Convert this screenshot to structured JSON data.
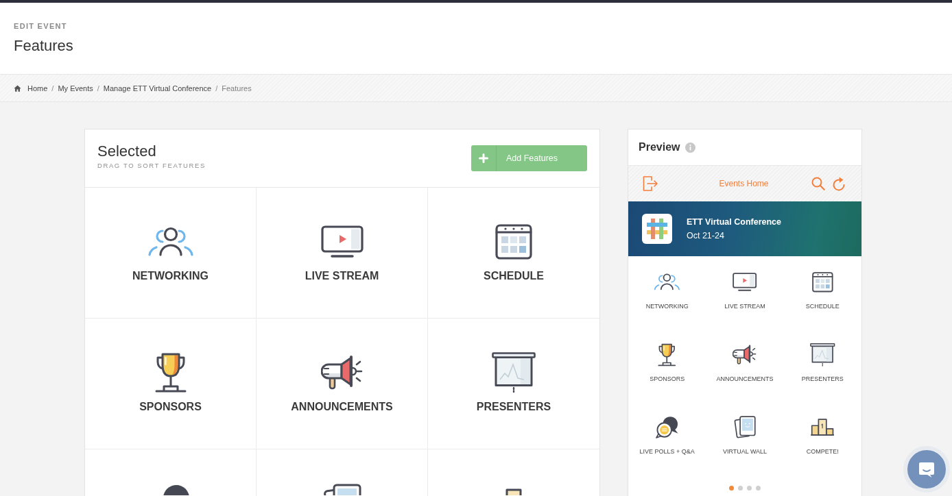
{
  "page": {
    "overline": "EDIT EVENT",
    "title": "Features"
  },
  "breadcrumb": {
    "items": [
      {
        "kind": "home",
        "label": "Home",
        "current": false
      },
      {
        "kind": "page",
        "label": "My Events",
        "current": false,
        "separator": "/"
      },
      {
        "kind": "page",
        "label": "Manage ETT Virtual Conference",
        "current": false,
        "separator": "/"
      },
      {
        "kind": "page",
        "label": "Features",
        "current": true,
        "separator": "/"
      }
    ]
  },
  "selected_panel": {
    "title": "Selected",
    "subtitle": "DRAG TO SORT FEATURES",
    "add_button": "Add Features",
    "features": [
      {
        "kind": "people",
        "label": "NETWORKING"
      },
      {
        "kind": "screen",
        "label": "LIVE STREAM"
      },
      {
        "kind": "calendar",
        "label": "SCHEDULE"
      },
      {
        "kind": "trophy",
        "label": "SPONSORS"
      },
      {
        "kind": "megaphone",
        "label": "ANNOUNCEMENTS"
      },
      {
        "kind": "projector",
        "label": "PRESENTERS"
      },
      {
        "kind": "bubbles"
      },
      {
        "kind": "cards"
      },
      {
        "kind": "podium"
      }
    ]
  },
  "preview": {
    "title": "Preview",
    "app_bar": {
      "title": "Events Home"
    },
    "event": {
      "name": "ETT Virtual Conference",
      "dates": "Oct 21-24"
    },
    "features": [
      {
        "kind": "people",
        "label": "NETWORKING"
      },
      {
        "kind": "screen",
        "label": "LIVE STREAM"
      },
      {
        "kind": "calendar",
        "label": "SCHEDULE"
      },
      {
        "kind": "trophy",
        "label": "SPONSORS"
      },
      {
        "kind": "megaphone",
        "label": "ANNOUNCEMENTS"
      },
      {
        "kind": "projector",
        "label": "PRESENTERS"
      },
      {
        "kind": "bubbles",
        "label": "LIVE POLLS + Q&A"
      },
      {
        "kind": "cards",
        "label": "VIRTUAL WALL"
      },
      {
        "kind": "podium",
        "label": "COMPETE!"
      }
    ],
    "pages": [
      {
        "selected": true
      },
      {
        "selected": false
      },
      {
        "selected": false
      },
      {
        "selected": false
      }
    ]
  }
}
